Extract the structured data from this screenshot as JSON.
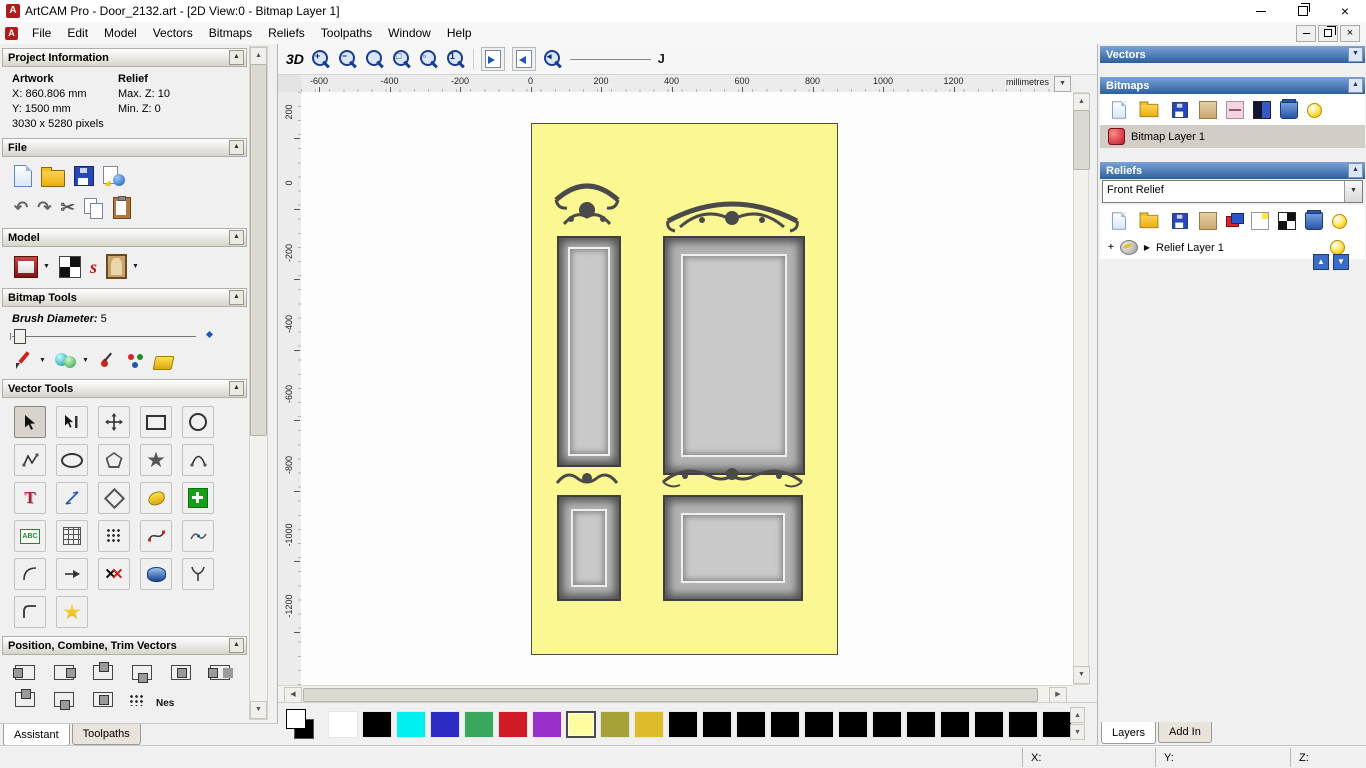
{
  "window": {
    "title": "ArtCAM Pro - Door_2132.art - [2D View:0 - Bitmap Layer 1]",
    "menus": [
      "File",
      "Edit",
      "Model",
      "Vectors",
      "Bitmaps",
      "Reliefs",
      "Toolpaths",
      "Window",
      "Help"
    ]
  },
  "left_panel": {
    "project_information": {
      "header": "Project Information",
      "artwork_label": "Artwork",
      "relief_label": "Relief",
      "x_value": "X: 860.806 mm",
      "max_z_value": "Max. Z: 10",
      "y_value": "Y: 1500 mm",
      "min_z_value": "Min. Z: 0",
      "pixels_value": "3030 x 5280 pixels"
    },
    "file_header": "File",
    "model_header": "Model",
    "bitmap_tools_header": "Bitmap Tools",
    "brush": {
      "label": "Brush Diameter:",
      "value": "5"
    },
    "vector_tools_header": "Vector Tools",
    "position_header": "Position, Combine, Trim Vectors",
    "nesting_label": "Nes",
    "tabs": {
      "assistant": "Assistant",
      "toolpaths": "Toolpaths"
    }
  },
  "canvas_toolbar": {
    "view_3d": "3D"
  },
  "rulers": {
    "h_ticks": [
      "-600",
      "-400",
      "-200",
      "0",
      "200",
      "400",
      "600",
      "800",
      "1000",
      "1200"
    ],
    "v_ticks": [
      "200",
      "0",
      "-200",
      "-400",
      "-600",
      "-800",
      "-1000",
      "-1200"
    ],
    "units": "millimetres"
  },
  "right_panel": {
    "vectors_header": "Vectors",
    "bitmaps_header": "Bitmaps",
    "bitmap_layer": "Bitmap Layer 1",
    "reliefs_header": "Reliefs",
    "relief_combo": "Front Relief",
    "relief_layer": "Relief Layer 1",
    "tabs": {
      "layers": "Layers",
      "add_in": "Add In"
    }
  },
  "status_bar": {
    "x": "X:",
    "y": "Y:",
    "z": "Z:"
  },
  "palette": {
    "colors": [
      "#ffffff",
      "#000000",
      "#00f0f0",
      "#2b2bc4",
      "#3aa85c",
      "#d01a26",
      "#9b2fc9",
      "#fdfc9e",
      "#a7a13a",
      "#debb2b",
      "#000000",
      "#000000",
      "#000000",
      "#000000",
      "#000000",
      "#000000",
      "#000000",
      "#000000",
      "#000000",
      "#000000",
      "#000000",
      "#000000"
    ]
  },
  "icons": {
    "collapse": "▲",
    "expand": "▼",
    "undo": "↶",
    "redo": "↷",
    "cut": "✂",
    "up": "▲",
    "down": "▼",
    "left": "◀",
    "right": "▶"
  }
}
